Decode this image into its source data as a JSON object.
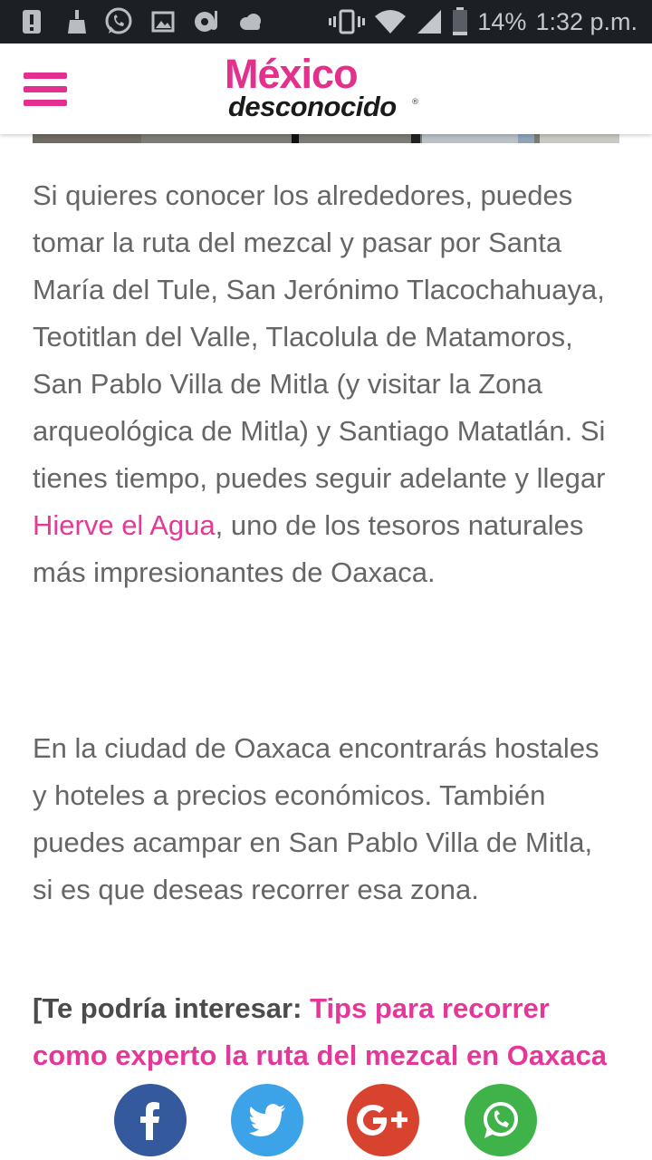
{
  "status_bar": {
    "battery_percent": "14%",
    "time": "1:32 p.m.",
    "icons": [
      "alert-icon",
      "broom-icon",
      "whatsapp-notification-icon",
      "image-icon",
      "music-icon",
      "cloud-icon",
      "vibrate-icon",
      "wifi-icon",
      "signal-icon",
      "battery-icon"
    ]
  },
  "header": {
    "logo_top": "México",
    "logo_bottom": "desconocido",
    "logo_registered": "®",
    "menu_icon": "hamburger-menu-icon"
  },
  "article": {
    "p1_before": "Si quieres conocer los alrededores, puedes tomar la ruta del mezcal y pasar por Santa María del Tule, San Jerónimo Tlacochahuaya, Teotitlan del Valle, Tlacolula de Matamoros, San Pablo Villa de Mitla (y visitar la Zona arqueológica de Mitla) y Santiago Matatlán. Si tienes tiempo, puedes seguir adelante y llegar ",
    "p1_link": "Hierve el Agua",
    "p1_after": ", uno de los tesoros naturales más impresionantes de Oaxaca.",
    "p2": "En la ciudad de Oaxaca encontrarás hostales y hoteles a precios económicos. También puedes acampar en San Pablo Villa de Mitla, si es que deseas recorrer esa zona.",
    "p3_label": "[Te podría interesar: ",
    "p3_link": "Tips para recorrer como experto la ruta del mezcal en Oaxaca"
  },
  "share_bar": {
    "facebook": "facebook-icon",
    "twitter": "twitter-icon",
    "google_plus": "google-plus-icon",
    "whatsapp": "whatsapp-icon"
  },
  "colors": {
    "brand_pink": "#e4308d",
    "status_bar_bg": "#1c1f24",
    "body_text": "#666666",
    "facebook": "#34599d",
    "twitter": "#3da3e9",
    "google_plus": "#d8432f",
    "whatsapp": "#3fb24a"
  }
}
